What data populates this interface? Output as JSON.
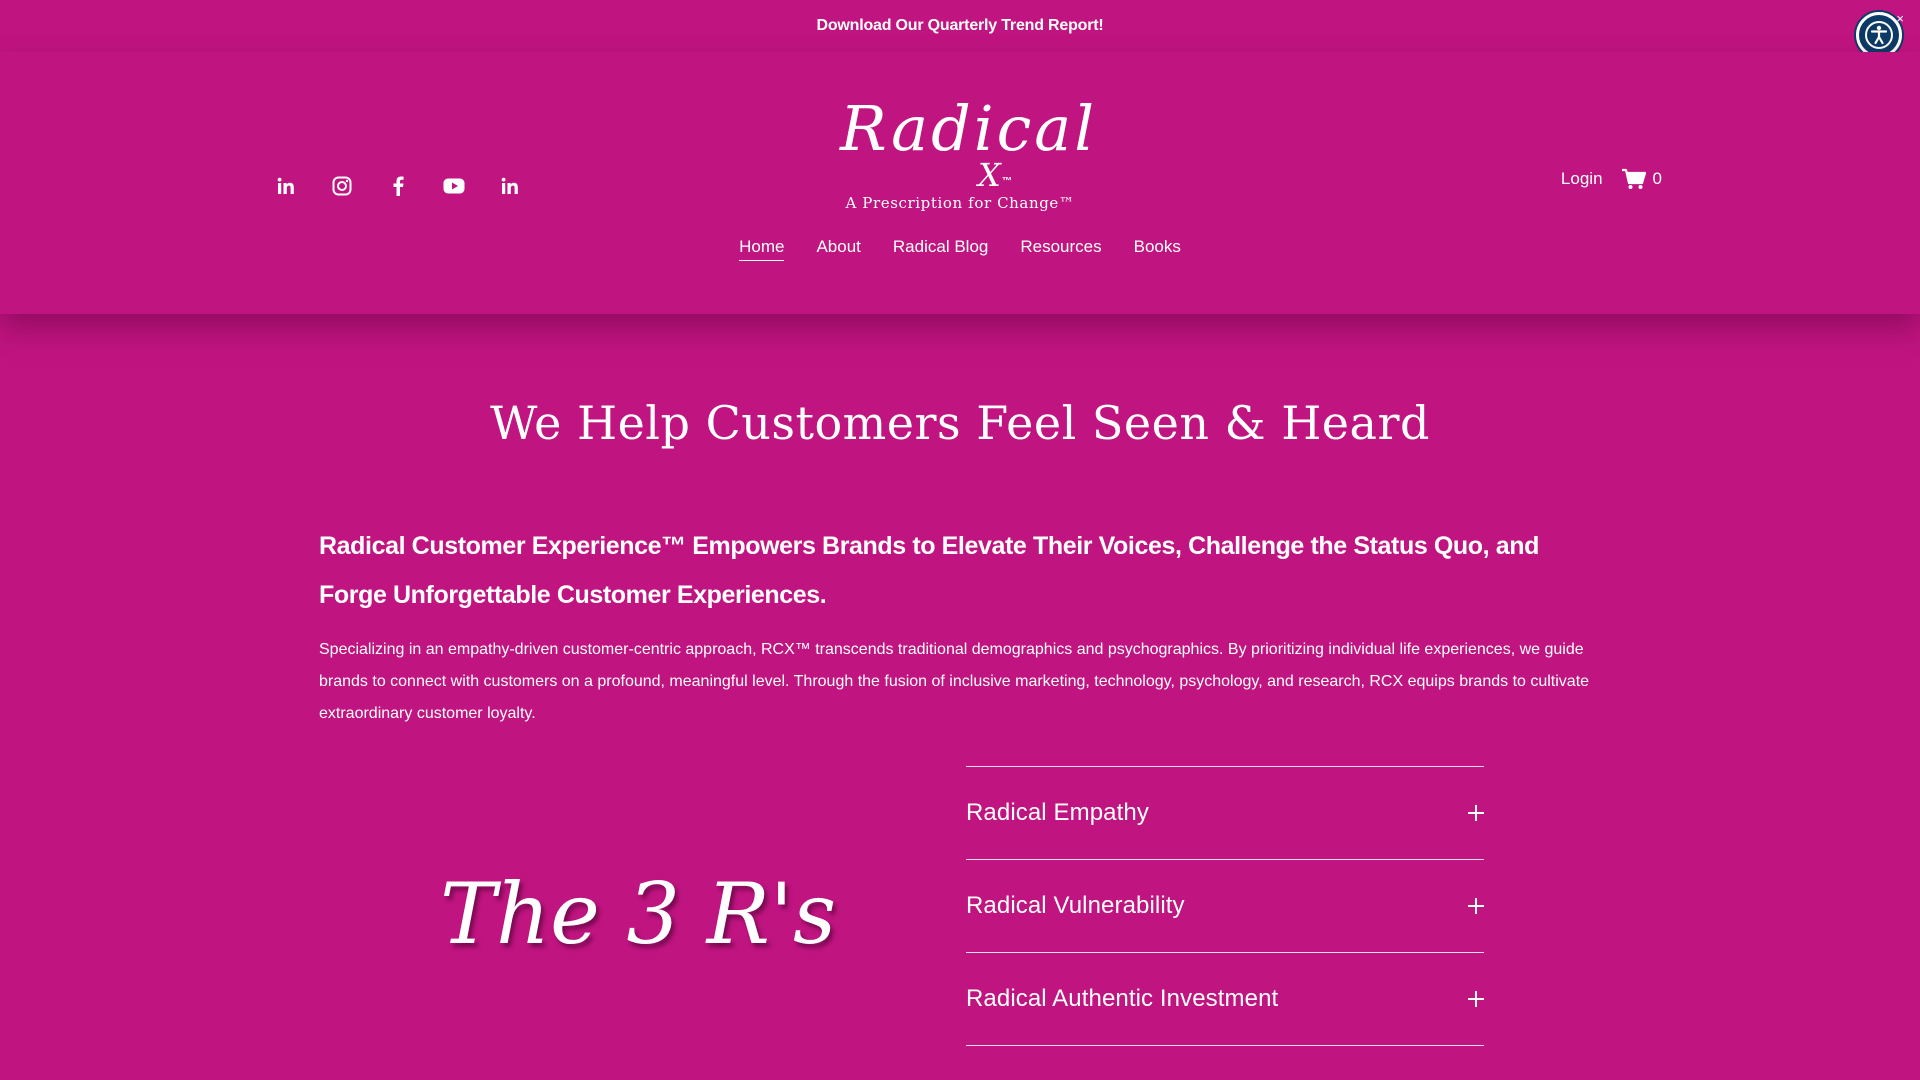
{
  "announcement": {
    "text": "Download Our Quarterly Trend Report!"
  },
  "accessibility": {
    "icon": "accessibility-icon",
    "close": "×"
  },
  "header": {
    "social": [
      {
        "icon": "linkedin-icon"
      },
      {
        "icon": "instagram-icon"
      },
      {
        "icon": "facebook-icon"
      },
      {
        "icon": "youtube-icon"
      },
      {
        "icon": "linkedin-icon"
      }
    ],
    "logo": {
      "script": "Radical",
      "x": "X",
      "tm": "™",
      "tagline": "A Prescription for Change™"
    },
    "login_label": "Login",
    "cart_count": "0"
  },
  "nav": [
    {
      "label": "Home"
    },
    {
      "label": "About"
    },
    {
      "label": "Radical Blog"
    },
    {
      "label": "Resources"
    },
    {
      "label": "Books"
    }
  ],
  "main": {
    "title": "We Help Customers Feel Seen & Heard",
    "subtitle": "Radical Customer Experience™ Empowers Brands to Elevate Their Voices, Challenge the Status Quo, and Forge Unforgettable Customer Experiences.",
    "body": "Specializing in an empathy-driven customer-centric approach, RCX™ transcends traditional demographics and psychographics. By prioritizing individual life experiences, we guide brands to connect with customers on a profound, meaningful level. Through the fusion of inclusive marketing, technology, psychology, and research, RCX equips brands to cultivate extraordinary customer loyalty.",
    "script_heading": "The 3 R's",
    "accordion": [
      {
        "label": "Radical Empathy"
      },
      {
        "label": "Radical Vulnerability"
      },
      {
        "label": "Radical Authentic Investment"
      }
    ]
  },
  "colors": {
    "background": "#c01480",
    "text": "#ffffff",
    "accessibility_button": "#0b3a66"
  }
}
